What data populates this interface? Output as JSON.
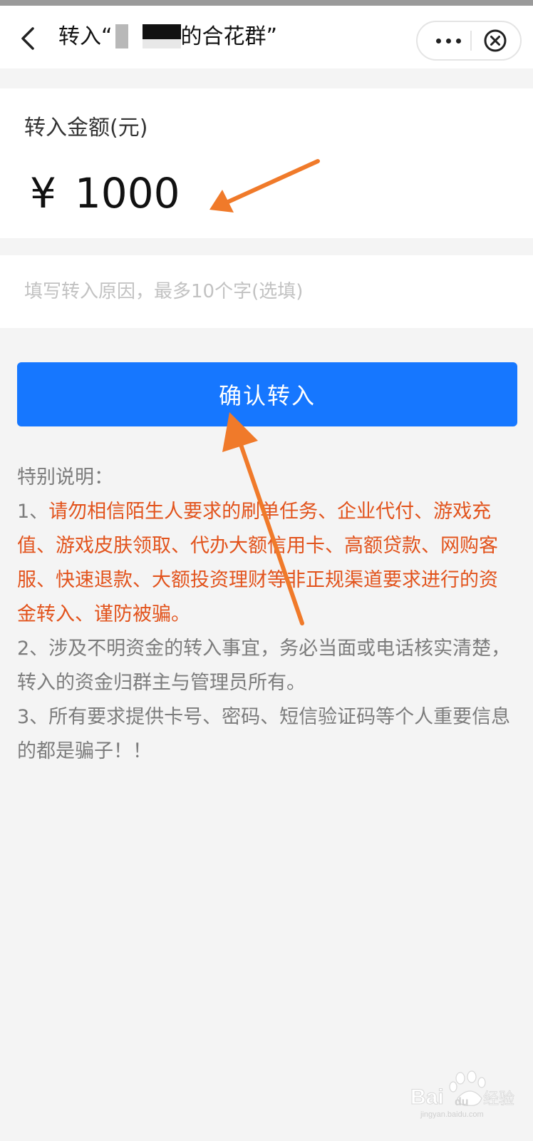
{
  "header": {
    "title_prefix": "转入“",
    "title_suffix": "的合花群”"
  },
  "amount": {
    "label": "转入金额(元)",
    "currency": "¥",
    "value": "1000"
  },
  "reason": {
    "placeholder": "填写转入原因，最多10个字(选填)"
  },
  "confirm_label": "确认转入",
  "notes": {
    "heading": "特别说明：",
    "item1_prefix": "1、",
    "item1_text": "请勿相信陌生人要求的刷单任务、企业代付、游戏充值、游戏皮肤领取、代办大额信用卡、高额贷款、网购客服、快速退款、大额投资理财等非正规渠道要求进行的资金转入、谨防被骗。",
    "item2": "2、涉及不明资金的转入事宜，务必当面或电话核实清楚，转入的资金归群主与管理员所有。",
    "item3": "3、所有要求提供卡号、密码、短信验证码等个人重要信息的都是骗子！！"
  },
  "watermark": {
    "text": "Bai du 经验",
    "sub": "jingyan.baidu.com"
  },
  "colors": {
    "primary": "#1677ff",
    "warning": "#e2531c",
    "annotation_arrow": "#f07a2a"
  }
}
